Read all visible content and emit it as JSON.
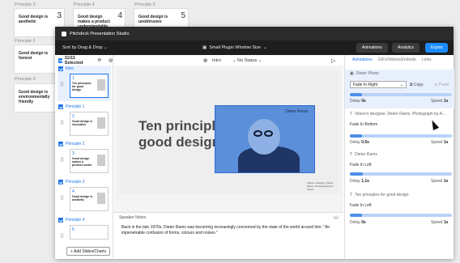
{
  "background": {
    "columns": [
      {
        "label": "Principle 3",
        "cards": [
          {
            "title": "Good design is aesthetic",
            "num": "3"
          },
          {
            "title": "Good design is honest",
            "num": ""
          },
          {
            "title": "Good design is environmentally friendly",
            "num": ""
          }
        ]
      },
      {
        "label": "Principle 4",
        "cards": [
          {
            "title": "Good design makes a product understandable",
            "num": "4"
          }
        ]
      },
      {
        "label": "Principle 5",
        "cards": [
          {
            "title": "Good design is unobtrusive",
            "num": "5"
          }
        ]
      }
    ],
    "side_labels": [
      "Principle 6",
      "Principle 8"
    ]
  },
  "window": {
    "title": "Pitchdeck Presentation Studio",
    "sort_label": "Sort by Drag & Drop",
    "size_label": "Small Plugin Window Size",
    "buttons": {
      "animations": "Animations",
      "analytics": "Analytics",
      "export": "Export"
    }
  },
  "left": {
    "selected": "11/11 Selected",
    "items": [
      {
        "label": "Intro",
        "num": "1",
        "title": "Ten principles for good design"
      },
      {
        "label": "Principle 1",
        "num": "2",
        "title": "Good design is innovative"
      },
      {
        "label": "Principle 2",
        "num": "3",
        "title": "Good design makes a product useful"
      },
      {
        "label": "Principle 3",
        "num": "4",
        "title": "Good design is aesthetic"
      },
      {
        "label": "Principle 4",
        "num": "5",
        "title": ""
      }
    ],
    "add_button": "Add Slides/Charts"
  },
  "center": {
    "slide_name": "Intro",
    "status": "No Status",
    "slide_title": "Ten principles for good design",
    "photo_name": "Dieter Rams",
    "caption": "Vitsoe's designer, Dieter Rams. Photographed by Vitsoe",
    "notes_label": "Speaker Notes",
    "notes_text": "Back in the late 1970s, Dieter Rams was becoming increasingly concerned by the state of the world around him: \"An impenetrable confusion of forms, colours and noises.\""
  },
  "right": {
    "tabs": [
      "Animations",
      "GIFs/Videos/Embeds",
      "Links"
    ],
    "blocks": [
      {
        "name": "Dieter Photo",
        "effect": "Fade In Right",
        "delay": "0s",
        "speed": "1s",
        "copy": "Copy",
        "paste": "Paste",
        "progress": 0.12
      },
      {
        "name": "Vitsoe's designer, Dieter Rams. Photograph by A...",
        "effect": "Fade In Bottom",
        "delay": "0.5s",
        "speed": "1s",
        "progress": 0.12
      },
      {
        "name": "Dieter Rams",
        "effect": "Fade In Left",
        "delay": "1.1s",
        "speed": "1s",
        "progress": 0.13
      },
      {
        "name": "Ten principles for good design",
        "effect": "Fade In Left",
        "delay": "0s",
        "speed": "1s",
        "progress": 0.12
      }
    ]
  }
}
